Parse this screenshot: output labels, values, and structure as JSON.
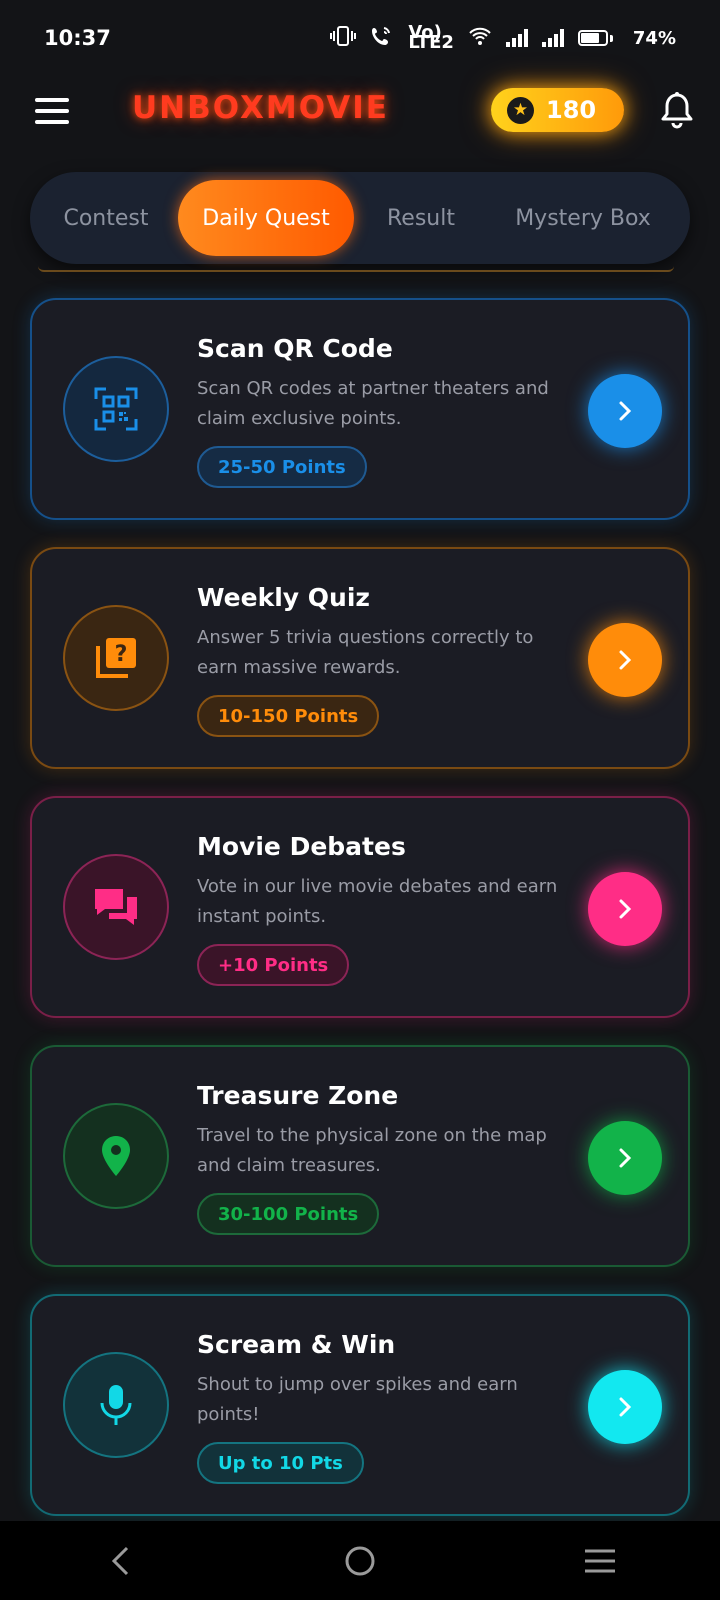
{
  "status": {
    "time": "10:37",
    "volte": "Vo)",
    "lte": "LTE2",
    "battery_pct": "74%"
  },
  "header": {
    "brand": "UNBOXMOVIE",
    "coins": "180"
  },
  "tabs": [
    {
      "label": "Contest",
      "active": false
    },
    {
      "label": "Daily Quest",
      "active": true
    },
    {
      "label": "Result",
      "active": false
    },
    {
      "label": "Mystery Box",
      "active": false
    }
  ],
  "cards": [
    {
      "title": "Scan QR Code",
      "desc": "Scan QR codes at partner theaters and claim exclusive points.",
      "badge": "25-50 Points",
      "icon": "qr-code-icon",
      "color": "#1a8fe8"
    },
    {
      "title": "Weekly Quiz",
      "desc": "Answer 5 trivia questions correctly to earn massive rewards.",
      "badge": "10-150 Points",
      "icon": "quiz-icon",
      "color": "#ff8c0a"
    },
    {
      "title": "Movie Debates",
      "desc": "Vote in our live movie debates and earn instant points.",
      "badge": "+10 Points",
      "icon": "chat-bubbles-icon",
      "color": "#ff2d86"
    },
    {
      "title": "Treasure Zone",
      "desc": "Travel to the physical zone on the map and claim treasures.",
      "badge": "30-100 Points",
      "icon": "map-pin-icon",
      "color": "#12b34a"
    },
    {
      "title": "Scream & Win",
      "desc": "Shout to jump over spikes and earn points!",
      "badge": "Up to 10 Pts",
      "icon": "microphone-icon",
      "color": "#12d8e6"
    }
  ]
}
